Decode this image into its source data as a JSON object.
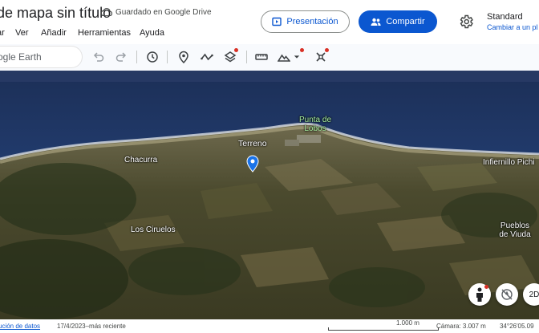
{
  "header": {
    "doc_title": "de mapa sin título",
    "drive_status": "Guardado en Google Drive",
    "present_label": "Presentación",
    "share_label": "Compartir",
    "map_style": "Standard",
    "map_style_link": "Cambiar a un pl"
  },
  "menu": [
    "ar",
    "Ver",
    "Añadir",
    "Herramientas",
    "Ayuda"
  ],
  "toolbar": {
    "search_placeholder": "ogle Earth",
    "icons": [
      "undo-icon",
      "redo-icon",
      "history-icon",
      "place-mark-icon",
      "path-icon",
      "layers-icon",
      "ruler-icon",
      "map-style-icon",
      "satellite-icon"
    ]
  },
  "map": {
    "places": {
      "punta_de_lobos": "Punta de Lobos",
      "terreno": "Terreno",
      "chacurra": "Chacurra",
      "infiernillo": "Infiernillo Pichi",
      "los_ciruelos": "Los Ciruelos",
      "pueblos_de_viuda": "Pueblos de Viuda"
    },
    "view_mode": "2D"
  },
  "status_bar": {
    "data_credit": "ución de datos",
    "imagery_date": "17/4/2023–más reciente",
    "scale": "1.000 m",
    "camera": "Cámara: 3.007 m",
    "coordinates": "34°26'05.09"
  },
  "colors": {
    "primary": "#0b57d0",
    "ocean": "#1d3663",
    "land": "#4a4a2c",
    "pin": "#1a73e8"
  }
}
